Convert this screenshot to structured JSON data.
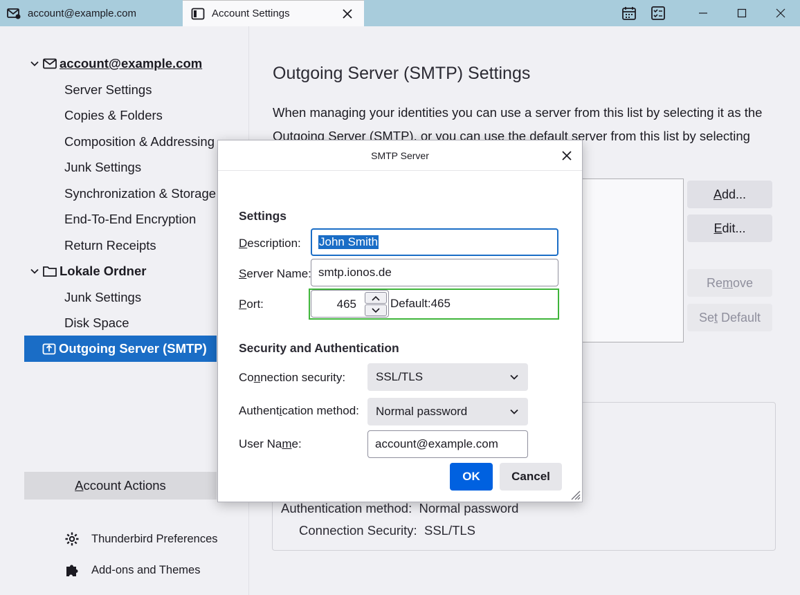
{
  "tabs": [
    {
      "label": "account@example.com",
      "icon": "mail-icon"
    },
    {
      "label": "Account Settings",
      "icon": "settings-tab-icon",
      "active": true
    }
  ],
  "sidebar": {
    "account": {
      "label": "account@example.com"
    },
    "account_items": [
      "Server Settings",
      "Copies & Folders",
      "Composition & Addressing",
      "Junk Settings",
      "Synchronization & Storage",
      "End-To-End Encryption",
      "Return Receipts"
    ],
    "local": {
      "label": "Lokale Ordner"
    },
    "local_items": [
      "Junk Settings",
      "Disk Space"
    ],
    "selected": "Outgoing Server (SMTP)",
    "account_actions": {
      "pre": "",
      "u": "A",
      "post": "ccount Actions"
    },
    "footer": [
      {
        "label": "Thunderbird Preferences",
        "icon": "gear-icon"
      },
      {
        "label": "Add-ons and Themes",
        "icon": "puzzle-icon"
      }
    ]
  },
  "main": {
    "title": "Outgoing Server (SMTP) Settings",
    "description": "When managing your identities you can use a server from this list by selecting it as the Outgoing Server (SMTP), or you can use the default server from this list by selecting",
    "buttons": {
      "add": {
        "u": "A",
        "post": "dd..."
      },
      "edit": {
        "u": "E",
        "post": "dit..."
      },
      "remove": {
        "pre": "Re",
        "u": "m",
        "post": "ove"
      },
      "set_default": {
        "pre": "Se",
        "u": "t",
        "post": " Default"
      }
    },
    "details": {
      "auth_label": "Authentication method:",
      "auth_value": "Normal password",
      "conn_label": "Connection Security:",
      "conn_value": "SSL/TLS"
    }
  },
  "dialog": {
    "title": "SMTP Server",
    "settings_heading": "Settings",
    "description": {
      "label_u": "D",
      "label_post": "escription:",
      "value": "John Smith"
    },
    "server_name": {
      "label_u": "S",
      "label_post": "erver Name:",
      "value": "smtp.ionos.de"
    },
    "port": {
      "label_u": "P",
      "label_post": "ort:",
      "value": "465",
      "default_text": "Default:465"
    },
    "security_heading": "Security and Authentication",
    "connection_security": {
      "label_pre": "Co",
      "label_u": "n",
      "label_post": "nection security:",
      "value": "SSL/TLS"
    },
    "auth_method": {
      "label_pre": "Authent",
      "label_u": "i",
      "label_post": "cation method:",
      "value": "Normal password"
    },
    "user_name": {
      "label_pre": "User Na",
      "label_u": "m",
      "label_post": "e:",
      "value": "account@example.com"
    },
    "ok": "OK",
    "cancel": "Cancel"
  },
  "colors": {
    "tabbar": "#a8ccdc",
    "selected_row": "#1a6dc6",
    "ok_button": "#0061e0",
    "port_highlight": "#3fb53a"
  }
}
